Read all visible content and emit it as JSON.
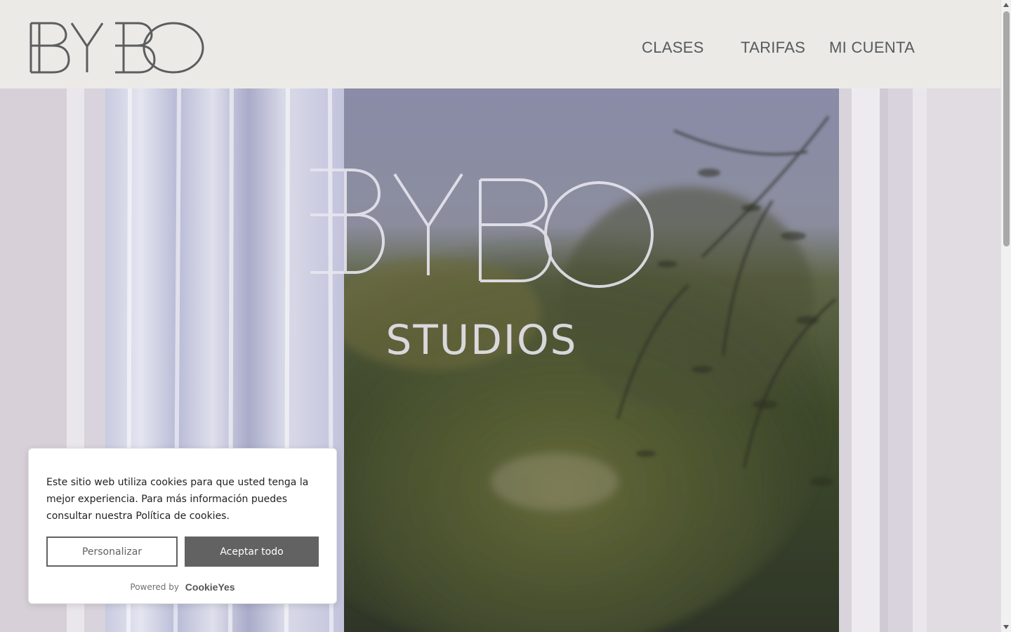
{
  "header": {
    "logo_text": "BYBO",
    "nav": [
      {
        "label": "CLASES"
      },
      {
        "label": "TARIFAS"
      },
      {
        "label": "MI CUENTA"
      }
    ]
  },
  "hero": {
    "window_sign_brand": "BYBO",
    "window_sign_sub": "STUDIOS"
  },
  "cookie_banner": {
    "message": "Este sitio web utiliza cookies para que usted tenga la mejor experiencia. Para más información puedes consultar nuestra Política de cookies.",
    "customize_label": "Personalizar",
    "accept_label": "Aceptar todo",
    "powered_by": "Powered by",
    "brand": "CookieYes"
  },
  "colors": {
    "header_bg": "#eceae6",
    "nav_text": "#555a5c",
    "button_dark": "#626262"
  }
}
